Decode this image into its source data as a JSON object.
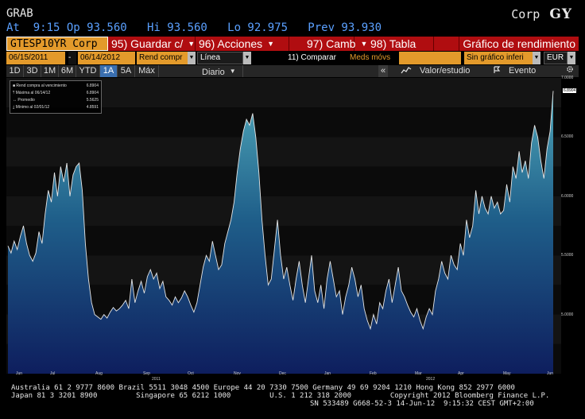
{
  "header": {
    "function_code": "GRAB",
    "security_line": "At  9:15 Op 93.560   Hi 93.560   Lo 92.975   Prev 93.930",
    "market_sector": "Corp",
    "exchange": "GY"
  },
  "toolbar": {
    "ticker": "GTESP10YR Corp",
    "save": "95) Guardar c/",
    "actions": "96) Acciones",
    "change": "97) Camb",
    "table": "98) Tabla",
    "title": "Gráfico de rendimiento"
  },
  "options": {
    "start_date": "06/15/2011",
    "end_date": "06/14/2012",
    "field": "Rend compr",
    "style": "Línea",
    "compare": "11) Comparar",
    "moving_avg": "Meds móvs",
    "events": "Sin gráfico inferi",
    "currency": "EUR"
  },
  "periods": [
    "1D",
    "3D",
    "1M",
    "6M",
    "YTD",
    "1A",
    "5A",
    "Máx"
  ],
  "active_period": "1A",
  "frequency": "Diario",
  "right_controls": {
    "collapse": "«",
    "value_study": "Valor/estudio",
    "event": "Evento",
    "settings_icon": "gear-icon"
  },
  "legend": {
    "rows": [
      {
        "label": "Rend compra al vencimiento",
        "value": "6.8904"
      },
      {
        "label": "Máxima al 06/14/12",
        "value": "6.8904"
      },
      {
        "label": "Promedio",
        "value": "5.5625"
      },
      {
        "label": "Mínimo al 02/01/12",
        "value": "4.8591"
      }
    ]
  },
  "chart_data": {
    "type": "area",
    "series": [
      {
        "name": "Rend compra al vencimiento",
        "values": [
          5.58,
          5.52,
          5.62,
          5.55,
          5.66,
          5.75,
          5.6,
          5.5,
          5.45,
          5.52,
          5.7,
          5.6,
          5.85,
          6.05,
          5.95,
          6.2,
          6.0,
          6.25,
          6.12,
          6.28,
          6.0,
          6.18,
          6.25,
          6.28,
          6.05,
          5.6,
          5.3,
          5.1,
          5.0,
          4.98,
          4.96,
          5.0,
          4.97,
          5.02,
          5.06,
          5.03,
          5.05,
          5.08,
          5.12,
          5.05,
          5.3,
          5.1,
          5.2,
          5.28,
          5.18,
          5.32,
          5.38,
          5.3,
          5.35,
          5.22,
          5.28,
          5.15,
          5.12,
          5.08,
          5.15,
          5.1,
          5.14,
          5.2,
          5.15,
          5.08,
          5.02,
          5.1,
          5.25,
          5.4,
          5.5,
          5.45,
          5.62,
          5.5,
          5.38,
          5.42,
          5.6,
          5.7,
          5.8,
          5.95,
          6.2,
          6.4,
          6.55,
          6.65,
          6.6,
          6.7,
          6.5,
          6.2,
          5.8,
          5.5,
          5.25,
          5.3,
          5.55,
          5.8,
          5.5,
          5.3,
          5.4,
          5.25,
          5.12,
          5.3,
          5.45,
          5.25,
          5.1,
          5.3,
          5.5,
          5.2,
          5.1,
          5.25,
          5.05,
          5.3,
          5.45,
          5.3,
          5.15,
          5.2,
          5.0,
          5.15,
          5.25,
          5.4,
          5.3,
          5.15,
          5.25,
          5.05,
          4.95,
          4.88,
          5.0,
          4.92,
          5.1,
          5.05,
          5.2,
          5.3,
          5.1,
          5.25,
          5.4,
          5.2,
          5.15,
          5.08,
          5.02,
          4.98,
          5.05,
          4.95,
          4.88,
          4.98,
          5.05,
          5.0,
          5.2,
          5.3,
          5.45,
          5.35,
          5.3,
          5.5,
          5.42,
          5.38,
          5.6,
          5.5,
          5.8,
          5.65,
          5.75,
          6.05,
          5.85,
          6.0,
          5.9,
          5.85,
          6.0,
          5.9,
          5.95,
          5.85,
          5.88,
          6.1,
          5.95,
          6.25,
          6.15,
          6.38,
          6.2,
          6.3,
          6.15,
          6.45,
          6.6,
          6.5,
          6.3,
          6.15,
          6.4,
          6.55,
          6.89
        ]
      }
    ],
    "ylim": [
      4.5,
      7.0
    ],
    "yticks": [
      "7.0000",
      "6.5000",
      "6.0000",
      "5.5000",
      "5.0000"
    ],
    "last_value_label": "6.8904",
    "x_months": [
      "Jun",
      "Jul",
      "Aug",
      "Sep",
      "Oct",
      "Nov",
      "Dec",
      "Jan",
      "Feb",
      "Mar",
      "Apr",
      "May",
      "Jun"
    ],
    "x_years": [
      "2011",
      "2012"
    ]
  },
  "footer": {
    "line1": "Australia 61 2 9777 8600 Brazil 5511 3048 4500 Europe 44 20 7330 7500 Germany 49 69 9204 1210 Hong Kong 852 2977 6000",
    "line2": "Japan 81 3 3201 8900         Singapore 65 6212 1000         U.S. 1 212 318 2000         Copyright 2012 Bloomberg Finance L.P.",
    "line3": "SN 533489 G668-52-3 14-Jun-12  9:15:32 CEST GMT+2:00"
  }
}
